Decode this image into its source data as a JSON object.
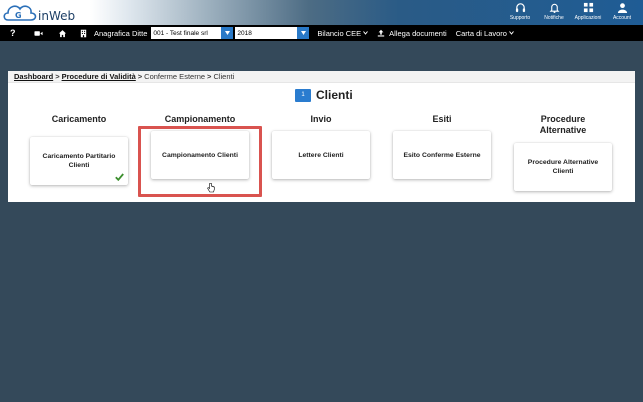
{
  "app": {
    "logo_text": "inWeb"
  },
  "top_actions": [
    {
      "id": "supporto",
      "label": "Supporto",
      "icon": "headset-icon"
    },
    {
      "id": "notifiche",
      "label": "Notifiche",
      "icon": "bell-icon"
    },
    {
      "id": "applicazioni",
      "label": "Applicazioni",
      "icon": "grid-icon"
    },
    {
      "id": "account",
      "label": "Account",
      "icon": "user-icon"
    }
  ],
  "toolbar": {
    "help": "?",
    "company_label": "Anagrafica Ditte",
    "company_value": "001 - Test finale srl",
    "year_value": "2018",
    "menu_bilancio": "Bilancio CEE",
    "menu_allega": "Allega documenti",
    "menu_carta": "Carta di Lavoro"
  },
  "breadcrumb": {
    "items": [
      "Dashboard",
      "Procedure di Validità",
      "Conferme Esterne",
      "Clienti"
    ]
  },
  "page": {
    "badge": "1",
    "title": "Clienti"
  },
  "columns": [
    {
      "heading": "Caricamento",
      "card": "Caricamento Partitario Clienti",
      "done": true
    },
    {
      "heading": "Campionamento",
      "card": "Campionamento Clienti",
      "done": false
    },
    {
      "heading": "Invio",
      "card": "Lettere Clienti",
      "done": false
    },
    {
      "heading": "Esiti",
      "card": "Esito Conferme Esterne",
      "done": false
    },
    {
      "heading": "Procedure Alternative",
      "card": "Procedure Alternative Clienti",
      "done": false
    }
  ],
  "colors": {
    "accent": "#2979c7",
    "highlight": "#d9534f",
    "check": "#3c8f2e",
    "background": "#34495a"
  }
}
